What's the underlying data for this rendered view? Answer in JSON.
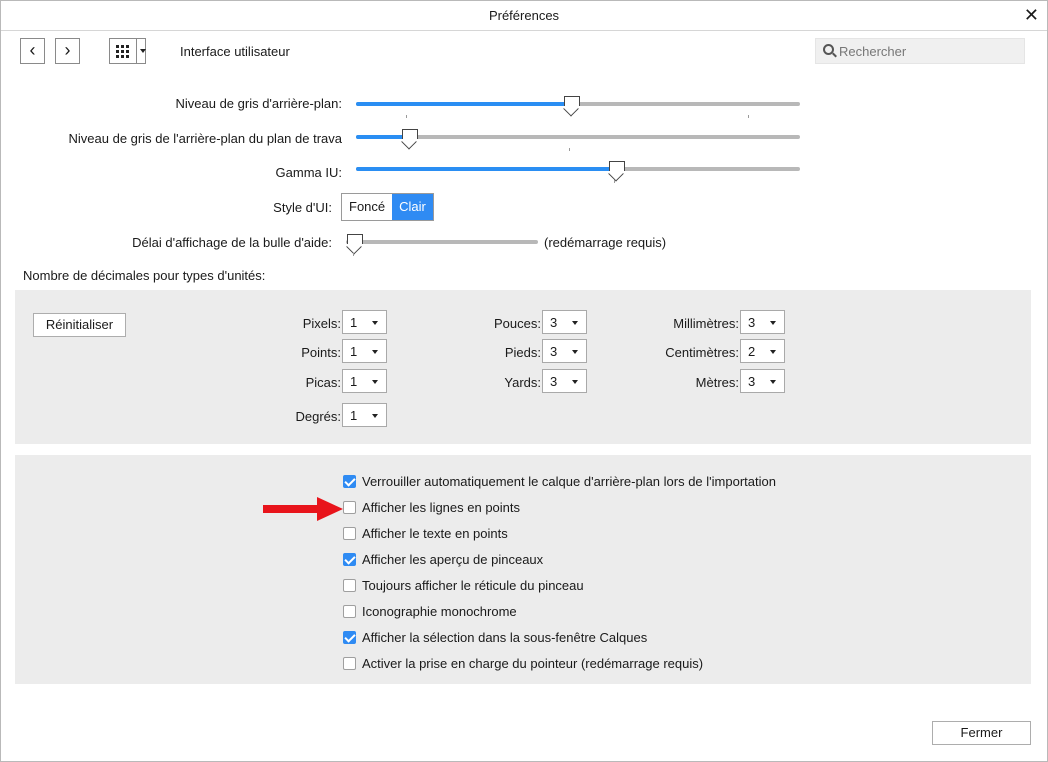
{
  "window": {
    "title": "Préférences"
  },
  "toolbar": {
    "current_section": "Interface utilisateur",
    "search_placeholder": "Rechercher"
  },
  "sliders": [
    {
      "label": "Niveau de gris d'arrière-plan:",
      "value": 0.5
    },
    {
      "label": "Niveau de gris de l'arrière-plan du plan de trava",
      "value": 0.12
    },
    {
      "label": "Gamma IU:",
      "value": 0.6
    }
  ],
  "ui_style": {
    "label": "Style d'UI:",
    "options": [
      "Foncé",
      "Clair"
    ],
    "selected": "Clair"
  },
  "tooltip_delay": {
    "label": "Délai d'affichage de la bulle d'aide:",
    "value": 0.0,
    "note": "(redémarrage requis)"
  },
  "decimals": {
    "heading": "Nombre de décimales pour types d'unités:",
    "reset_label": "Réinitialiser",
    "units": [
      {
        "label": "Pixels:",
        "value": "1"
      },
      {
        "label": "Points:",
        "value": "1"
      },
      {
        "label": "Picas:",
        "value": "1"
      },
      {
        "label": "Degrés:",
        "value": "1"
      },
      {
        "label": "Pouces:",
        "value": "3"
      },
      {
        "label": "Pieds:",
        "value": "3"
      },
      {
        "label": "Yards:",
        "value": "3"
      },
      {
        "label": "Millimètres:",
        "value": "3"
      },
      {
        "label": "Centimètres:",
        "value": "2"
      },
      {
        "label": "Mètres:",
        "value": "3"
      }
    ]
  },
  "options": [
    {
      "label": "Verrouiller automatiquement le calque d'arrière-plan lors de l'importation",
      "checked": true
    },
    {
      "label": "Afficher les lignes en points",
      "checked": false
    },
    {
      "label": "Afficher le texte en points",
      "checked": false
    },
    {
      "label": "Afficher les aperçu de pinceaux",
      "checked": true
    },
    {
      "label": "Toujours afficher le réticule du pinceau",
      "checked": false
    },
    {
      "label": "Iconographie monochrome",
      "checked": false
    },
    {
      "label": "Afficher la sélection dans la sous-fenêtre Calques",
      "checked": true
    },
    {
      "label": "Activer la prise en charge du pointeur (redémarrage requis)",
      "checked": false
    }
  ],
  "footer": {
    "close_label": "Fermer"
  },
  "colors": {
    "accent": "#2f8bf3",
    "annotation_arrow": "#e8141b"
  }
}
